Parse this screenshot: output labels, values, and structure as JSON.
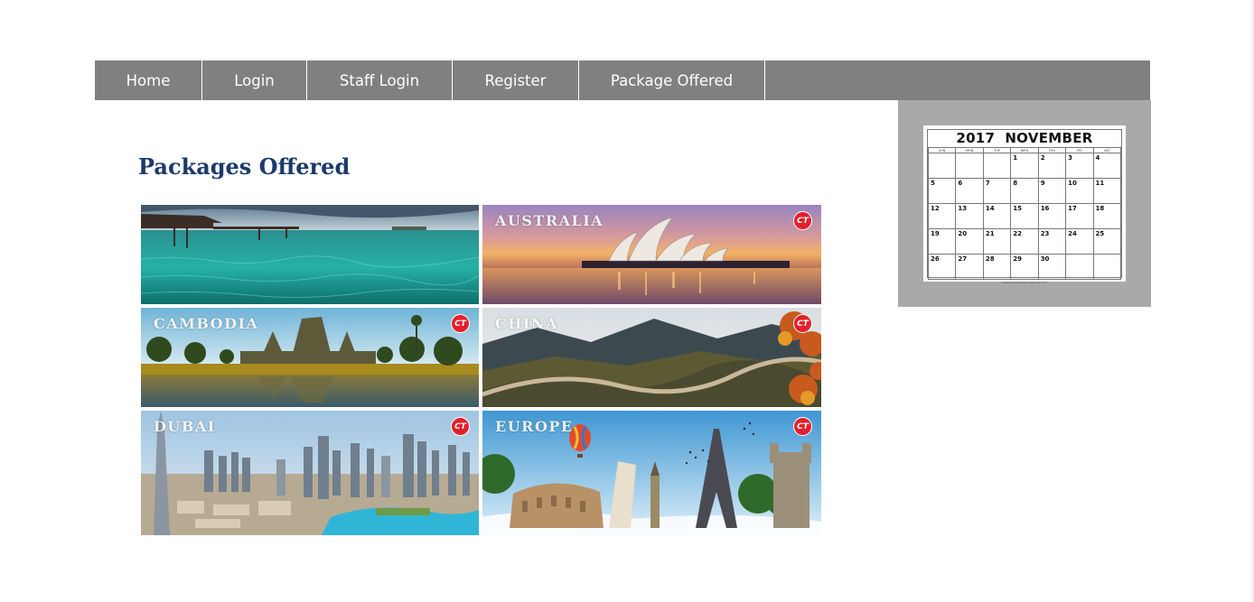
{
  "nav": {
    "items": [
      {
        "label": "Home"
      },
      {
        "label": "Login"
      },
      {
        "label": "Staff Login"
      },
      {
        "label": "Register"
      },
      {
        "label": "Package Offered"
      }
    ]
  },
  "page": {
    "title": "Packages Offered"
  },
  "packages": [
    {
      "name": "maldives",
      "label": ""
    },
    {
      "name": "australia",
      "label": "Australia"
    },
    {
      "name": "cambodia",
      "label": "Cambodia"
    },
    {
      "name": "china",
      "label": "China"
    },
    {
      "name": "dubai",
      "label": "Dubai"
    },
    {
      "name": "europe",
      "label": "Europe"
    }
  ],
  "calendar": {
    "year": "2017",
    "month": "NOVEMBER",
    "weekdays": [
      "SUN",
      "MON",
      "TUE",
      "WED",
      "THU",
      "FRI",
      "SAT"
    ],
    "weeks": [
      [
        "",
        "",
        "",
        "1",
        "2",
        "3",
        "4"
      ],
      [
        "5",
        "6",
        "7",
        "8",
        "9",
        "10",
        "11"
      ],
      [
        "12",
        "13",
        "14",
        "15",
        "16",
        "17",
        "18"
      ],
      [
        "19",
        "20",
        "21",
        "22",
        "23",
        "24",
        "25"
      ],
      [
        "26",
        "27",
        "28",
        "29",
        "30",
        "",
        ""
      ]
    ],
    "footer": "www.free-printable-calendar.com"
  },
  "colors": {
    "nav_bg": "#808080",
    "title": "#1b3a6b",
    "calendar_frame": "#a9a9a9",
    "logo": "#e3202a"
  }
}
